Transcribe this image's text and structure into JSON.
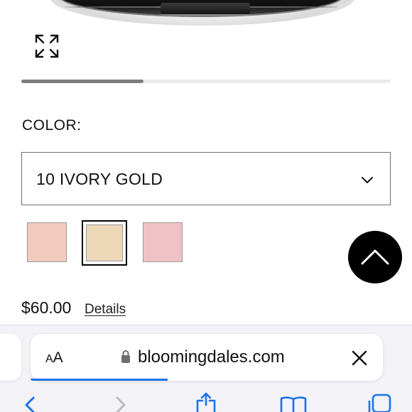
{
  "product": {
    "color_label": "COLOR:",
    "selected_shade": "10 IVORY GOLD",
    "image_carousel_progress": 0.33,
    "swatches": [
      {
        "color": "#f1cbbd",
        "selected": false
      },
      {
        "color": "#ecd7b7",
        "selected": true
      },
      {
        "color": "#efc3c6",
        "selected": false
      }
    ],
    "price": "$60.00",
    "details_link": "Details"
  },
  "browser": {
    "reader_label_small": "A",
    "reader_label_large": "A",
    "url": "bloomingdales.com",
    "page_load_progress": 0.39
  },
  "colors": {
    "accent_progress": "#1a73e8",
    "toolbar_icon": "#1a73e8",
    "scroll_top_bg": "#000000"
  }
}
